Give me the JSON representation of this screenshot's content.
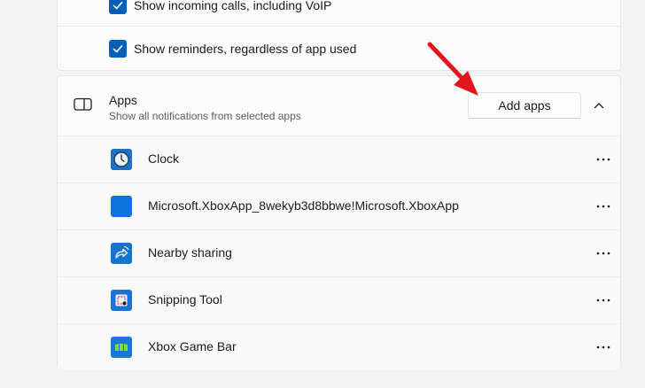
{
  "notifications": {
    "calls_label": "Show incoming calls, including VoIP",
    "reminders_label": "Show reminders, regardless of app used"
  },
  "apps_section": {
    "title": "Apps",
    "subtitle": "Show all notifications from selected apps",
    "add_button_label": "Add apps",
    "items": [
      {
        "name": "Clock",
        "icon": "clock-icon"
      },
      {
        "name": "Microsoft.XboxApp_8wekyb3d8bbwe!Microsoft.XboxApp",
        "icon": "xbox-app-icon"
      },
      {
        "name": "Nearby sharing",
        "icon": "nearby-sharing-icon"
      },
      {
        "name": "Snipping Tool",
        "icon": "snipping-tool-icon"
      },
      {
        "name": "Xbox Game Bar",
        "icon": "xbox-game-bar-icon"
      }
    ]
  },
  "colors": {
    "accent": "#005fb8",
    "annotation_arrow": "#e3161f",
    "background": "#f3f3f3",
    "card": "#fbfbfb"
  }
}
